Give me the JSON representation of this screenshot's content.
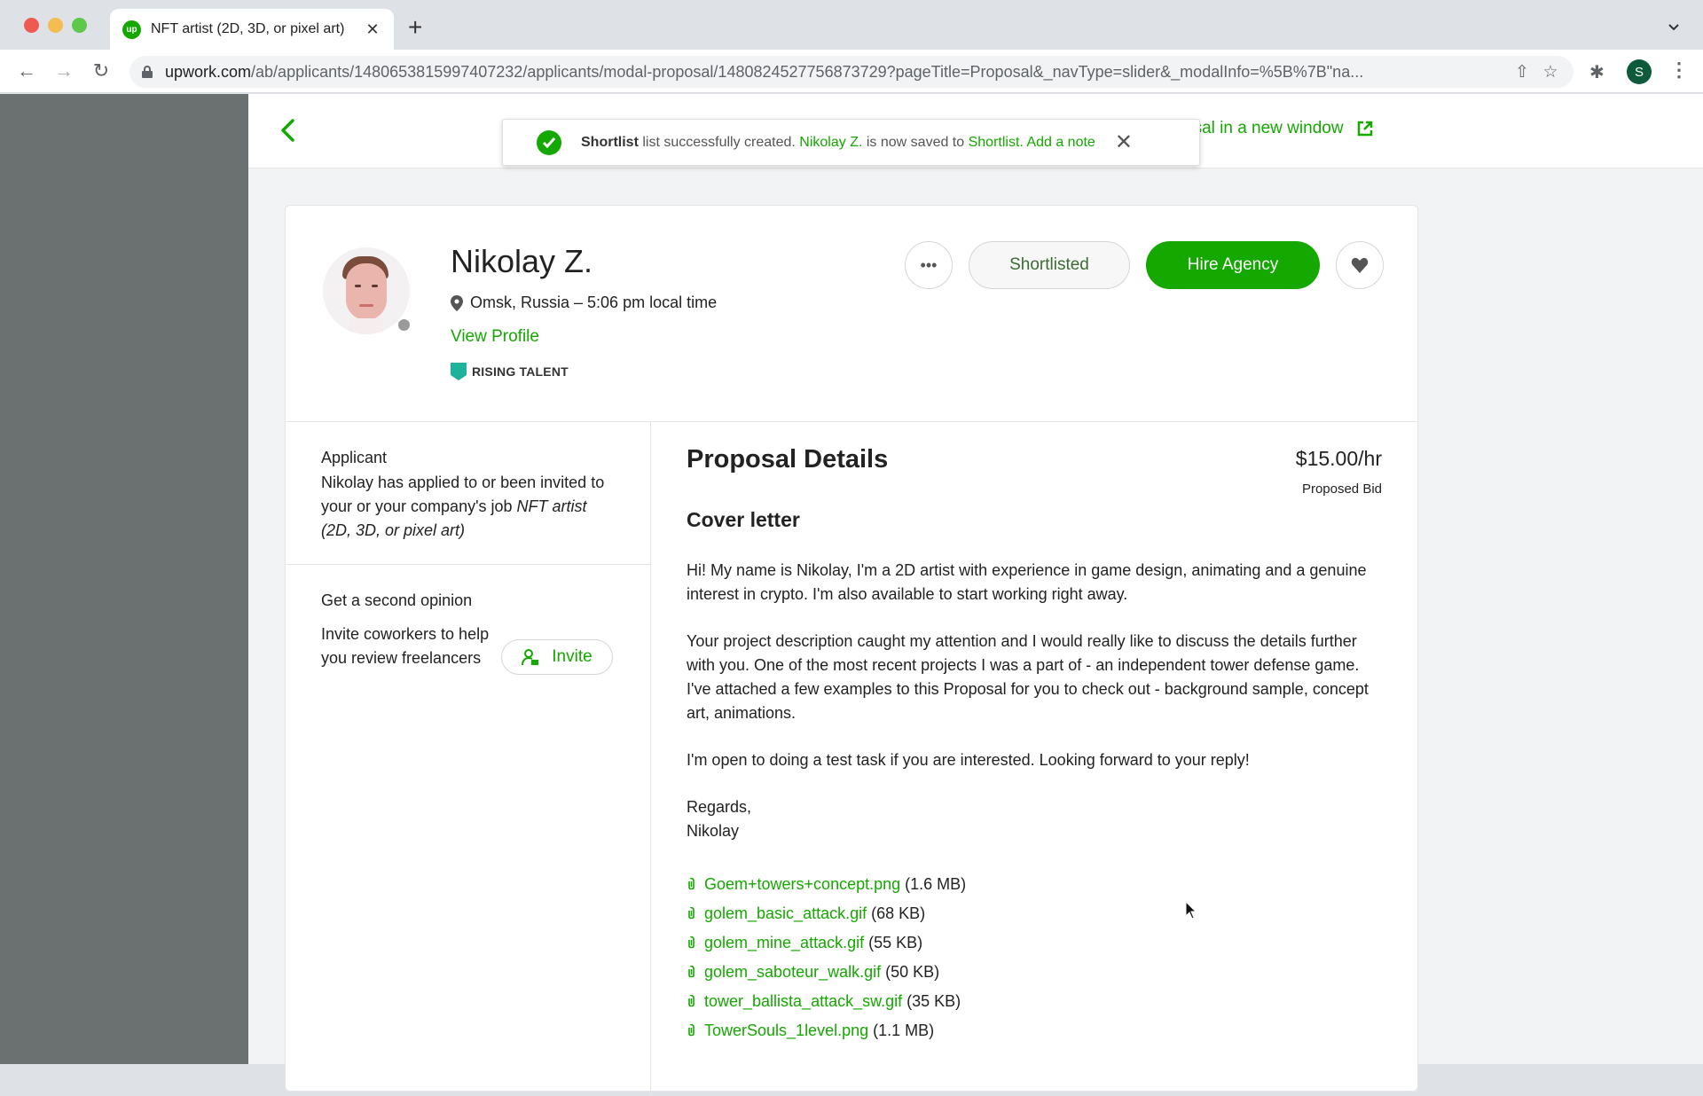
{
  "browser": {
    "tab": {
      "title": "NFT artist (2D, 3D, or pixel art)",
      "favicon": "up"
    },
    "url": {
      "host": "upwork.com",
      "path": "/ab/applicants/1480653815997407232/applicants/modal-proposal/1480824527756873729?pageTitle=Proposal&_navType=slider&_modalInfo=%5B%7B\"na..."
    },
    "profile_initial": "S"
  },
  "header": {
    "open_new_window_label": "osal in a new window"
  },
  "toast": {
    "list_name": "Shortlist",
    "text_1": " list successfully created. ",
    "freelancer": "Nikolay Z.",
    "text_2": " is now saved to ",
    "saved_to": "Shortlist.",
    "add_note": " Add a note"
  },
  "profile": {
    "name": "Nikolay Z.",
    "location": "Omsk, Russia – 5:06 pm local time",
    "view_profile": "View Profile",
    "badge": "RISING TALENT",
    "actions": {
      "more_label": "•••",
      "shortlisted": "Shortlisted",
      "hire": "Hire Agency"
    }
  },
  "sidebar": {
    "applicant_title": "Applicant",
    "applicant_body": "Nikolay has applied to or been invited to your or your company's job ",
    "job_title": "NFT artist (2D, 3D, or pixel art)",
    "opinion_title": "Get a second opinion",
    "opinion_body": "Invite coworkers to help you review freelancers",
    "invite_label": "Invite"
  },
  "proposal": {
    "title": "Proposal Details",
    "bid_amount": "$15.00/hr",
    "bid_label": "Proposed Bid",
    "cover_title": "Cover letter",
    "paragraphs": [
      "Hi! My name is Nikolay, I'm a 2D artist with experience in game design, animating and a genuine interest in crypto. I'm also available to start working right away.",
      "Your project description caught my attention and I would really like to discuss the details further with you. One of the most recent projects I was a part of - an independent tower defense game. I've attached a few examples to this Proposal for you to check out - background sample, concept art, animations.",
      "I'm open to doing a test task if you are interested. Looking forward to your reply!"
    ],
    "signoff_1": "Regards,",
    "signoff_2": "Nikolay",
    "attachments": [
      {
        "name": "Goem+towers+concept.png",
        "size": "(1.6 MB)"
      },
      {
        "name": "golem_basic_attack.gif",
        "size": "(68 KB)"
      },
      {
        "name": "golem_mine_attack.gif",
        "size": "(55 KB)"
      },
      {
        "name": "golem_saboteur_walk.gif",
        "size": "(50 KB)"
      },
      {
        "name": "tower_ballista_attack_sw.gif",
        "size": "(35 KB)"
      },
      {
        "name": "TowerSouls_1level.png",
        "size": "(1.1 MB)"
      }
    ]
  },
  "colors": {
    "brand": "#14a800",
    "badge": "#1fb29a"
  }
}
